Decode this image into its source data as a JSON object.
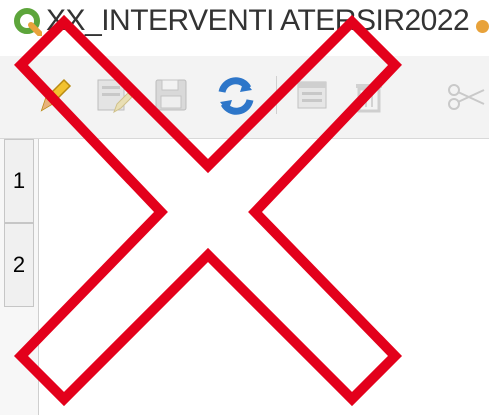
{
  "window": {
    "title": "XX_INTERVENTI ATERSIR2022",
    "logo_icon": "qgis-logo-icon"
  },
  "toolbar": {
    "tools": [
      {
        "name": "toggle-editing",
        "icon": "pencil-icon"
      },
      {
        "name": "multi-edit",
        "icon": "multi-edit-icon"
      },
      {
        "name": "save-edits",
        "icon": "save-icon"
      },
      {
        "name": "reload",
        "icon": "refresh-icon"
      },
      {
        "name": "add-feature",
        "icon": "add-row-icon"
      },
      {
        "name": "delete-feature",
        "icon": "trash-icon"
      },
      {
        "name": "cut",
        "icon": "scissors-icon"
      }
    ]
  },
  "table": {
    "rows": [
      {
        "number": "1"
      },
      {
        "number": "2"
      }
    ]
  },
  "overlay": {
    "icon": "red-cross-icon",
    "color": "#e3001b"
  }
}
